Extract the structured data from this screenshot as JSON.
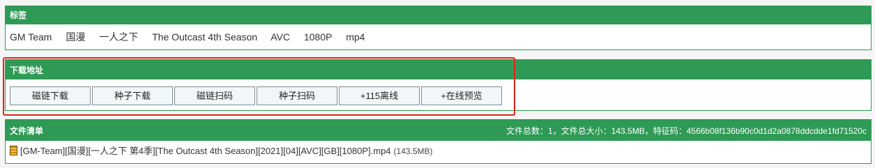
{
  "tags": {
    "title": "标签",
    "items": [
      "GM Team",
      "国漫",
      "一人之下",
      "The Outcast 4th Season",
      "AVC",
      "1080P",
      "mp4"
    ]
  },
  "downloads": {
    "title": "下载地址",
    "buttons": [
      "磁链下载",
      "种子下载",
      "磁链扫码",
      "种子扫码",
      "+115离线",
      "+在线预览"
    ]
  },
  "files": {
    "title": "文件清单",
    "summary": "文件总数：1，文件总大小：143.5MB，特征码：4566b08f136b90c0d1d2a0878ddcdde1fd71520c",
    "items": [
      {
        "name": "[GM-Team][国漫][一人之下 第4季][The Outcast 4th Season][2021][04][AVC][GB][1080P].mp4",
        "size": "(143.5MB)"
      }
    ]
  },
  "colors": {
    "header": "#2e9a55",
    "highlight": "#e0241c"
  }
}
